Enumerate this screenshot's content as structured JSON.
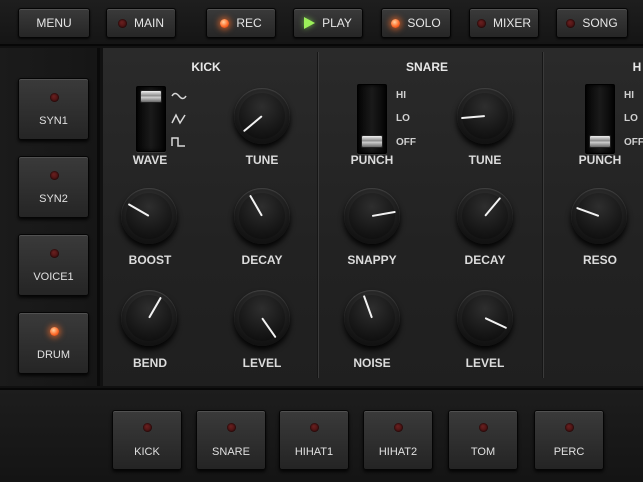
{
  "topbar": {
    "menu": "MENU",
    "main": "MAIN",
    "rec": "REC",
    "play": "PLAY",
    "solo": "SOLO",
    "mixer": "MIXER",
    "song": "SONG"
  },
  "side": {
    "syn1": "SYN1",
    "syn2": "SYN2",
    "voice1": "VOICE1",
    "drum": "DRUM"
  },
  "kick": {
    "title": "KICK",
    "wave": "WAVE",
    "tune": "TUNE",
    "boost": "BOOST",
    "decay": "DECAY",
    "bend": "BEND",
    "level": "LEVEL"
  },
  "snare": {
    "title": "SNARE",
    "punch": "PUNCH",
    "tune": "TUNE",
    "snappy": "SNAPPY",
    "decay": "DECAY",
    "noise": "NOISE",
    "level": "LEVEL",
    "opt_hi": "HI",
    "opt_lo": "LO",
    "opt_off": "OFF"
  },
  "hihat": {
    "title": "H",
    "punch": "PUNCH",
    "reso": "RESO",
    "opt_hi": "HI",
    "opt_lo": "LO",
    "opt_off": "OFF"
  },
  "pads": [
    "KICK",
    "SNARE",
    "HIHAT1",
    "HIHAT2",
    "TOM",
    "PERC"
  ],
  "colors": {
    "led_on": "#ff6a28",
    "play_arrow": "#9cf05a",
    "panel": "#262626"
  }
}
